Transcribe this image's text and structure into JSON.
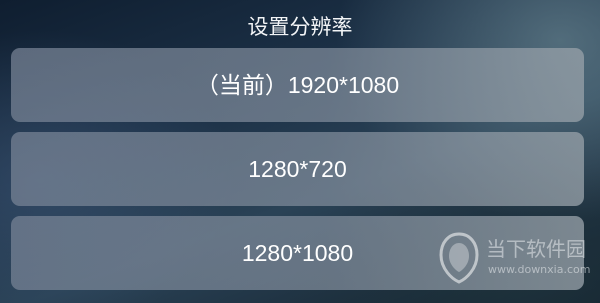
{
  "dialog": {
    "title": "设置分辨率",
    "options": [
      {
        "label": "（当前）1920*1080",
        "selected": true
      },
      {
        "label": "1280*720",
        "selected": false
      },
      {
        "label": "1280*1080",
        "selected": false
      }
    ]
  },
  "watermark": {
    "name": "当下软件园",
    "url": "www.downxia.com"
  },
  "colors": {
    "option_bg": "#7f8a9a",
    "text": "#ffffff",
    "background_dark": "#13212c"
  }
}
